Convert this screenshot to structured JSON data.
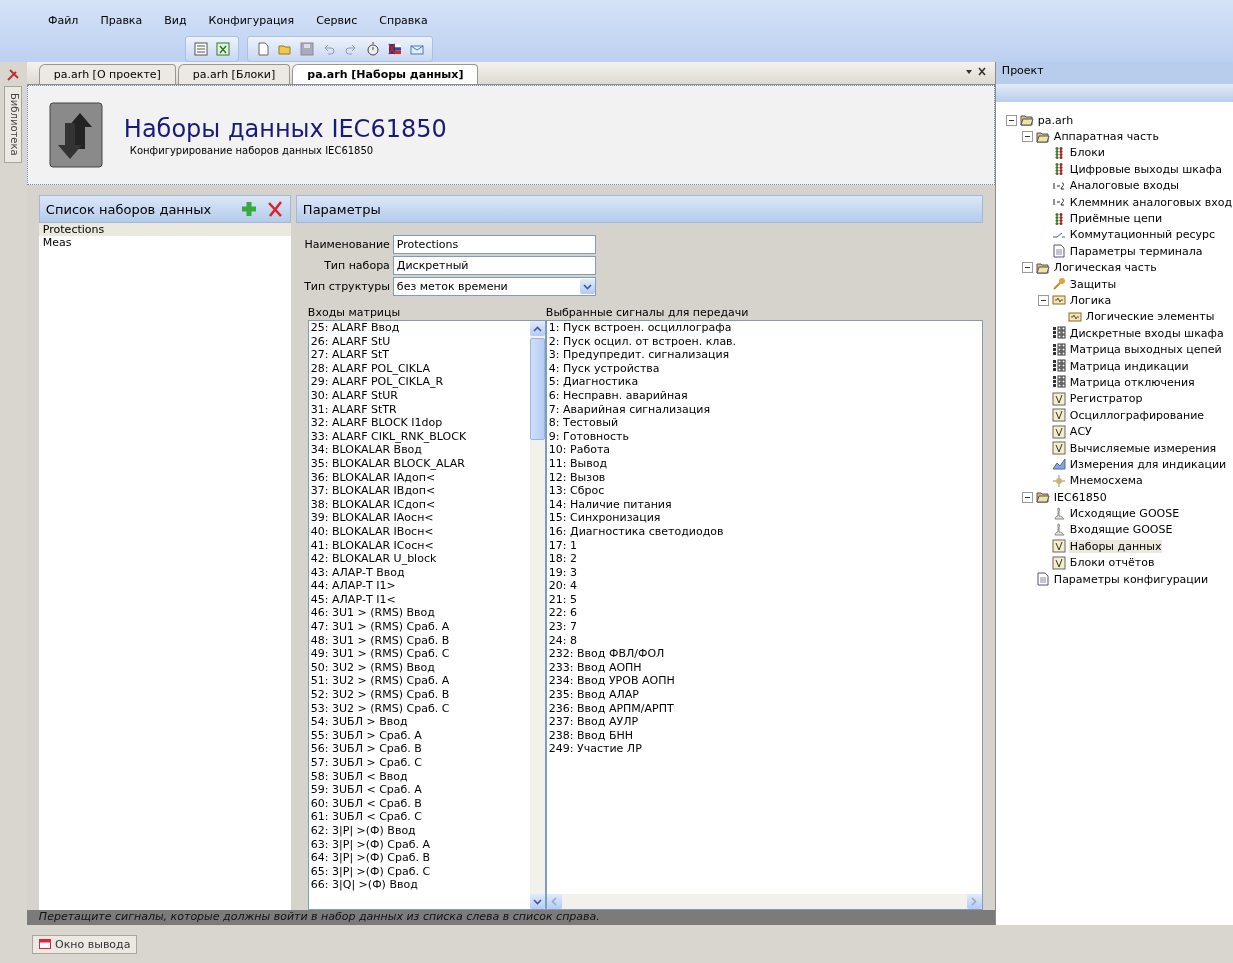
{
  "menu": [
    "Файл",
    "Правка",
    "Вид",
    "Конфигурация",
    "Сервис",
    "Справка"
  ],
  "sidebar_tab": "Библиотека",
  "tabs": [
    {
      "label": "pa.arh [О проекте]",
      "selected": false
    },
    {
      "label": "pa.arh [Блоки]",
      "selected": false
    },
    {
      "label": "pa.arh [Наборы данных]",
      "selected": true
    }
  ],
  "header": {
    "title": "Наборы данных IEC61850",
    "subtitle": "Конфигурирование наборов данных IEC61850"
  },
  "datasets": {
    "title": "Список наборов данных",
    "items": [
      {
        "label": "Protections",
        "selected": true
      },
      {
        "label": "Meas",
        "selected": false
      }
    ]
  },
  "parameters": {
    "title": "Параметры",
    "fields": [
      {
        "label": "Наименование",
        "value": "Protections",
        "kind": "text"
      },
      {
        "label": "Тип набора",
        "value": "Дискретный",
        "kind": "text"
      },
      {
        "label": "Тип структуры",
        "value": "без меток времени",
        "kind": "dropdown"
      }
    ],
    "inputs": {
      "title": "Входы матрицы",
      "items": [
        "25: ALARF Ввод",
        "26: ALARF StU",
        "27: ALARF StT",
        "28: ALARF POL_CIKLA",
        "29: ALARF POL_CIKLA_R",
        "30: ALARF StUR",
        "31: ALARF StTR",
        "32: ALARF BLOCK I1dop",
        "33: ALARF CIKL_RNK_BLOCK",
        "34: BLOKALAR Ввод",
        "35: BLOKALAR BLOCK_ALAR",
        "36: BLOKALAR IАдоп<",
        "37: BLOKALAR IВдоп<",
        "38: BLOKALAR IСдоп<",
        "39: BLOKALAR IАосн<",
        "40: BLOKALAR IВосн<",
        "41: BLOKALAR IСосн<",
        "42: BLOKALAR U_block",
        "43: АЛАР-Т Ввод",
        "44: АЛАР-Т I1>",
        "45: АЛАР-Т I1<",
        "46: 3U1 > (RMS) Ввод",
        "47: 3U1 > (RMS) Сраб. A",
        "48: 3U1 > (RMS) Сраб. B",
        "49: 3U1 > (RMS) Сраб. C",
        "50: 3U2 > (RMS) Ввод",
        "51: 3U2 > (RMS) Сраб. A",
        "52: 3U2 > (RMS) Сраб. B",
        "53: 3U2 > (RMS) Сраб. C",
        "54: 3UБЛ > Ввод",
        "55: 3UБЛ > Сраб. A",
        "56: 3UБЛ > Сраб. B",
        "57: 3UБЛ > Сраб. C",
        "58: 3UБЛ < Ввод",
        "59: 3UБЛ < Сраб. A",
        "60: 3UБЛ < Сраб. B",
        "61: 3UБЛ < Сраб. C",
        "62: 3|P| >(Ф) Ввод",
        "63: 3|P| >(Ф) Сраб. A",
        "64: 3|P| >(Ф) Сраб. B",
        "65: 3|P| >(Ф) Сраб. C",
        "66: 3|Q| >(Ф) Ввод"
      ]
    },
    "selected_signals": {
      "title": "Выбранные сигналы для передачи",
      "items": [
        "1: Пуск встроен. осциллографа",
        "2: Пуск осцил. от встроен. клав.",
        "3: Предупредит. сигнализация",
        "4: Пуск устройства",
        "5: Диагностика",
        "6: Несправн. аварийная",
        "7: Аварийная сигнализация",
        "8: Тестовый",
        "9: Готовность",
        "10: Работа",
        "11: Вывод",
        "12: Вызов",
        "13: Сброс",
        "14: Наличие питания",
        "15: Синхронизация",
        "16: Диагностика светодиодов",
        "17: 1",
        "18: 2",
        "19: 3",
        "20: 4",
        "21: 5",
        "22: 6",
        "23: 7",
        "24: 8",
        "232: Ввод ФВЛ/ФОЛ",
        "233: Ввод АОПН",
        "234: Ввод УРОВ АОПН",
        "235: Ввод АЛАР",
        "236: Ввод АРПМ/АРПТ",
        "237: Ввод АУЛР",
        "238: Ввод БНН",
        "249: Участие ЛР"
      ]
    },
    "hint": "Перетащите сигналы, которые должны войти в набор данных из списка слева в список справа."
  },
  "output_tab": "Окно вывода",
  "project": {
    "title": "Проект",
    "tree": [
      {
        "label": "pa.arh",
        "kind": "folder",
        "expanded": true,
        "selected": false,
        "children": [
          {
            "label": "Аппаратная часть",
            "kind": "folder",
            "expanded": true,
            "selected": false,
            "children": [
              {
                "label": "Блоки",
                "kind": "leds",
                "selected": false
              },
              {
                "label": "Цифровые выходы шкафа",
                "kind": "leds",
                "selected": false
              },
              {
                "label": "Аналоговые входы",
                "kind": "numbers",
                "selected": false
              },
              {
                "label": "Клеммник аналоговых вход",
                "kind": "numbers",
                "selected": false
              },
              {
                "label": "Приёмные цепи",
                "kind": "leds",
                "selected": false
              },
              {
                "label": "Коммутационный ресурс",
                "kind": "switch",
                "selected": false
              },
              {
                "label": "Параметры терминала",
                "kind": "doc",
                "selected": false
              }
            ]
          },
          {
            "label": "Логическая часть",
            "kind": "folder",
            "expanded": true,
            "selected": false,
            "children": [
              {
                "label": "Защиты",
                "kind": "key",
                "selected": false
              },
              {
                "label": "Логика",
                "kind": "logic",
                "expanded": true,
                "selected": false,
                "children": [
                  {
                    "label": "Логические элементы",
                    "kind": "logic",
                    "selected": false
                  }
                ]
              },
              {
                "label": "Дискретные входы шкафа",
                "kind": "matrix",
                "selected": false
              },
              {
                "label": "Матрица выходных цепей",
                "kind": "matrix",
                "selected": false
              },
              {
                "label": "Матрица индикации",
                "kind": "matrix",
                "selected": false
              },
              {
                "label": "Матрица отключения",
                "kind": "matrix",
                "selected": false
              },
              {
                "label": "Регистратор",
                "kind": "form",
                "selected": false
              },
              {
                "label": "Осциллографирование",
                "kind": "form",
                "selected": false
              },
              {
                "label": "АСУ",
                "kind": "form",
                "selected": false
              },
              {
                "label": "Вычисляемые измерения",
                "kind": "form",
                "selected": false
              },
              {
                "label": "Измерения для индикации",
                "kind": "chart",
                "selected": false
              },
              {
                "label": "Мнемосхема",
                "kind": "scheme",
                "selected": false
              }
            ]
          },
          {
            "label": "IEC61850",
            "kind": "folder",
            "expanded": true,
            "selected": false,
            "children": [
              {
                "label": "Исходящие GOOSE",
                "kind": "goose",
                "selected": false
              },
              {
                "label": "Входящие GOOSE",
                "kind": "goose",
                "selected": false
              },
              {
                "label": "Наборы данных",
                "kind": "form",
                "selected": true
              },
              {
                "label": "Блоки отчётов",
                "kind": "form",
                "selected": false
              }
            ]
          },
          {
            "label": "Параметры конфигурации",
            "kind": "doc",
            "selected": false
          }
        ]
      }
    ]
  }
}
